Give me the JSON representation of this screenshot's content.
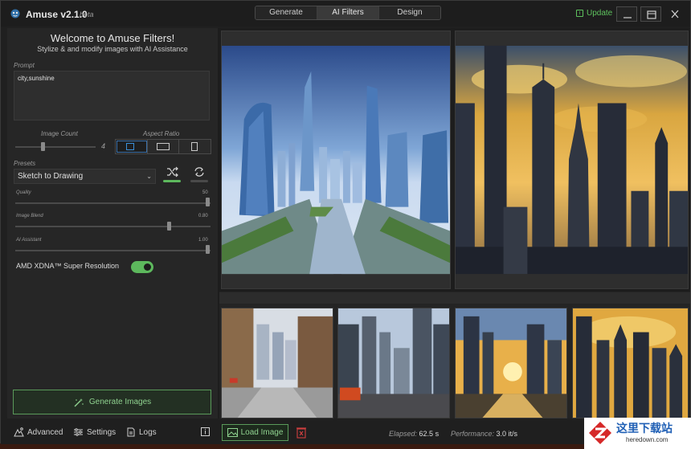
{
  "app": {
    "name": "Amuse v2.1.0",
    "badge": "beta",
    "update_label": "Update"
  },
  "mode_tabs": [
    {
      "label": "Generate",
      "active": false
    },
    {
      "label": "AI Filters",
      "active": true
    },
    {
      "label": "Design",
      "active": false
    }
  ],
  "panel": {
    "title": "Welcome to Amuse Filters!",
    "subtitle": "Stylize & and modify images with AI Assistance",
    "prompt_label": "Prompt",
    "prompt_value": "city,sunshine",
    "image_count_label": "Image Count",
    "image_count_value": "4",
    "image_count_level": 0.33,
    "aspect_ratio_label": "Aspect Ratio",
    "aspect_ratio_options": [
      "square",
      "landscape",
      "portrait"
    ],
    "aspect_ratio_selected": "square",
    "presets_label": "Presets",
    "preset_selected": "Sketch to Drawing",
    "quality_label": "Quality",
    "quality_value": "50",
    "quality_level": 1.0,
    "image_blend_label": "Image Blend",
    "image_blend_value": "0.80",
    "image_blend_level": 0.8,
    "ai_assistant_label": "AI Assistant",
    "ai_assistant_value": "1.00",
    "ai_assistant_level": 1.0,
    "super_resolution_label": "AMD XDNA™ Super Resolution",
    "super_resolution_on": true,
    "generate_label": "Generate Images"
  },
  "bottom": {
    "advanced_label": "Advanced",
    "settings_label": "Settings",
    "logs_label": "Logs",
    "load_image_label": "Load Image",
    "elapsed_label": "Elapsed:",
    "elapsed_value": "62.5 s",
    "performance_label": "Performance:",
    "performance_value": "3.0 it/s"
  },
  "watermark": {
    "title": "这里下载站",
    "url": "heredown.com"
  },
  "colors": {
    "accent_green": "#5db85d",
    "selection_blue": "#3a6fa8",
    "window_bg": "#202020",
    "panel_bg": "#262626"
  },
  "icons": [
    "app-logo-icon",
    "update-icon",
    "minimize-icon",
    "maximize-icon",
    "close-icon",
    "shuffle-icon",
    "refresh-icon",
    "magic-wand-icon",
    "advanced-icon",
    "settings-icon",
    "logs-icon",
    "info-icon",
    "image-icon",
    "delete-icon"
  ]
}
